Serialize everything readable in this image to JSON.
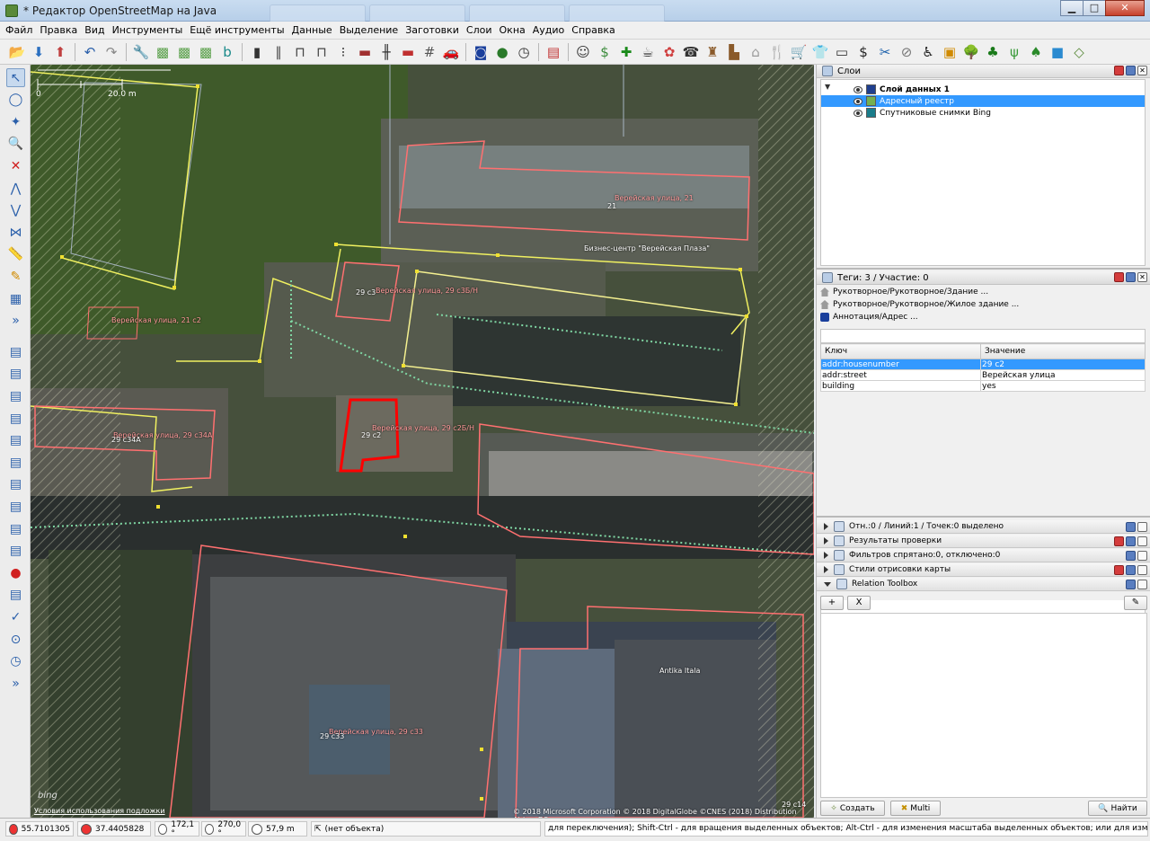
{
  "window": {
    "title": "* Редактор OpenStreetMap на Java"
  },
  "menu": [
    "Файл",
    "Правка",
    "Вид",
    "Инструменты",
    "Ещё инструменты",
    "Данные",
    "Выделение",
    "Заготовки",
    "Слои",
    "Окна",
    "Аудио",
    "Справка"
  ],
  "toolbar_icons": [
    "open-icon",
    "download-icon",
    "upload-icon",
    "undo-icon",
    "redo-icon",
    "preferences-icon",
    "imagery-icon",
    "imagery-icon",
    "imagery-icon",
    "bing-icon",
    "building-icon",
    "road-icon",
    "bridge-icon",
    "tunnel-icon",
    "traffic-signals-icon",
    "wall-icon",
    "railway-icon",
    "barrier-icon",
    "fence-icon",
    "car-icon",
    "route-icon",
    "globe-icon",
    "clock-icon",
    "russia-flag-icon",
    "theatre-icon",
    "cash-icon",
    "pharmacy-icon",
    "cafe-icon",
    "balloons-icon",
    "telephone-icon",
    "castle-icon",
    "factory-icon",
    "church-icon",
    "restaurant-icon",
    "shopping-cart-icon",
    "shirt-icon",
    "wallet-icon",
    "dollar-icon",
    "hairdresser-icon",
    "clip-icon",
    "wheelchair-icon",
    "shopping-bag-icon",
    "tree-icon",
    "forest-icon",
    "meadow-icon",
    "shrub-icon",
    "water-icon",
    "area-icon"
  ],
  "left_tools": [
    "select-icon",
    "lasso-icon",
    "draw-node-icon",
    "zoom-icon",
    "delete-icon",
    "combine-icon",
    "split-icon",
    "join-icon",
    "measure-icon",
    "pencil-icon",
    "building-tool-icon",
    "more-icon",
    "layers-toggle-icon",
    "properties-toggle-icon",
    "selection-list-icon",
    "relation-icon",
    "commands-icon",
    "history-icon",
    "author-icon",
    "validation-icon",
    "filter-icon",
    "map-paint-icon",
    "notes-icon",
    "gps-icon",
    "todo-icon",
    "imagery-offset-icon",
    "tag-checker-icon",
    "sidebar-expand-icon"
  ],
  "map": {
    "scale_label": "20.0 m",
    "labels": [
      {
        "text": "Верейская улица, 21",
        "class": "pink"
      },
      {
        "text": "21",
        "class": "white"
      },
      {
        "text": "Бизнес-центр \"Верейская Плаза\"",
        "class": "white"
      },
      {
        "text": "29 с3",
        "class": "white"
      },
      {
        "text": "Верейская улица, 29 с3Б/Н",
        "class": "pink"
      },
      {
        "text": "Верейская улица, 21 с2",
        "class": "pink"
      },
      {
        "text": "Верейская улица, 29 с34А",
        "class": "pink"
      },
      {
        "text": "29 с34А",
        "class": "white"
      },
      {
        "text": "Верейская улица, 29 с2Б/Н",
        "class": "pink"
      },
      {
        "text": "29 с2",
        "class": "white"
      },
      {
        "text": "Antika Itala",
        "class": "white"
      },
      {
        "text": "Верейская улица, 29 с33",
        "class": "pink"
      },
      {
        "text": "29 с33",
        "class": "white"
      },
      {
        "text": "29 с14",
        "class": "white"
      }
    ],
    "bing_mark": "bing",
    "terms_link": "Условия использования подложки",
    "attribution": "© 2018 Microsoft Corporation © 2018 DigitalGlobe ©CNES (2018) Distribution Airbus DS"
  },
  "layers_panel": {
    "title": "Слои",
    "layers": [
      {
        "name": "Слой данных 1",
        "bold": true,
        "selected": false,
        "icon_color": "#1f3f8f"
      },
      {
        "name": "Адресный реестр",
        "bold": false,
        "selected": true,
        "icon_color": "#74b050"
      },
      {
        "name": "Спутниковые снимки Bing",
        "bold": false,
        "selected": false,
        "icon_color": "#1a7c8a"
      }
    ]
  },
  "tags_panel": {
    "title": "Теги: 3 / Участие: 0",
    "presets": [
      {
        "label": "Рукотворное/Рукотворное/Здание ...",
        "icon": "building-preset-icon"
      },
      {
        "label": "Рукотворное/Рукотворное/Жилое здание ...",
        "icon": "house-preset-icon"
      },
      {
        "label": "Аннотация/Адрес ...",
        "icon": "address-preset-icon"
      }
    ],
    "columns": [
      "Ключ",
      "Значение"
    ],
    "rows": [
      {
        "key": "addr:housenumber",
        "value": "29 с2",
        "selected": true
      },
      {
        "key": "addr:street",
        "value": "Верейская улица",
        "selected": false
      },
      {
        "key": "building",
        "value": "yes",
        "selected": false
      }
    ]
  },
  "collapsed_panels": [
    {
      "label": "Отн.:0 / Линий:1 / Точек:0 выделено",
      "expanded": false
    },
    {
      "label": "Результаты проверки",
      "expanded": false
    },
    {
      "label": "Фильтров спрятано:0, отключено:0",
      "expanded": false
    },
    {
      "label": "Стили отрисовки карты",
      "expanded": false
    },
    {
      "label": "Relation Toolbox",
      "expanded": true
    }
  ],
  "relation_toolbox": {
    "add_label": "+",
    "remove_label": "X",
    "edit_label": "✎"
  },
  "bottom_buttons": {
    "create": "Создать",
    "multi": "Multi",
    "find": "Найти"
  },
  "status": {
    "lat": "55.7101305",
    "lon": "37.4405828",
    "heading": "172,1 °",
    "angle": "270,0 °",
    "distance": "57,9 m",
    "object": "(нет объекта)",
    "help": "для переключения); Shift-Ctrl - для вращения выделенных объектов; Alt-Ctrl - для изменения масштаба выделенных объектов; или для изменения выделения"
  },
  "colors": {
    "selection_blue": "#3399ff",
    "building_outline": "#ff7070",
    "selected_way": "#ff0000",
    "parcel_yellow": "#f0f060",
    "dotted_green": "#7fd6a3"
  }
}
